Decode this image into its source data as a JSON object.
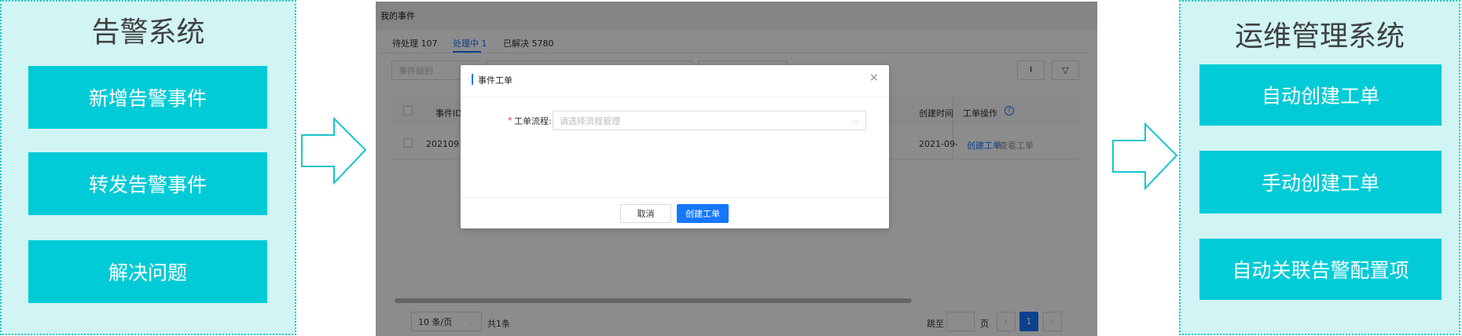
{
  "left_panel": {
    "title": "告警系统",
    "items": [
      "新增告警事件",
      "转发告警事件",
      "解决问题"
    ]
  },
  "right_panel": {
    "title": "运维管理系统",
    "items": [
      "自动创建工单",
      "手动创建工单",
      "自动关联告警配置项"
    ]
  },
  "colors": {
    "panel_bg": "#d1f4f4",
    "box": "#00cbd6",
    "arrow": "#19c5cc",
    "primary": "#1677ff"
  },
  "app": {
    "page_title": "我的事件",
    "tabs": [
      {
        "label": "待处理 107"
      },
      {
        "label": "处理中 1",
        "active": true
      },
      {
        "label": "已解决 5780"
      }
    ],
    "filter_placeholder": "事件级别",
    "table": {
      "headers": {
        "id": "事件ID",
        "created": "创建时间",
        "ops": "工单操作"
      },
      "rows": [
        {
          "id": "202109",
          "created": "2021-09-",
          "create_link": "创建工单",
          "view_link": "查看工单"
        }
      ]
    },
    "pagination": {
      "page_size": "10 条/页",
      "total": "共1条",
      "jump_label": "跳至",
      "page_unit": "页",
      "current_page": "1"
    },
    "modal": {
      "title": "事件工单",
      "field_label": "工单流程:",
      "required_mark": "*",
      "field_placeholder": "请选择流程管理",
      "cancel": "取消",
      "submit": "创建工单"
    }
  }
}
